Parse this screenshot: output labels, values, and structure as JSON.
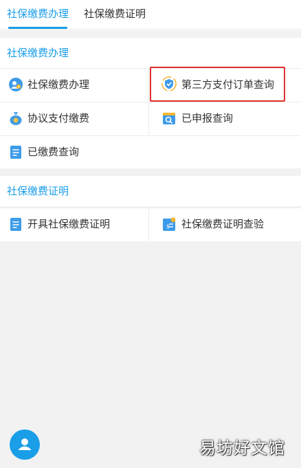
{
  "tabs": [
    {
      "label": "社保缴费办理",
      "active": true
    },
    {
      "label": "社保缴费证明",
      "active": false
    }
  ],
  "sections": [
    {
      "title": "社保缴费办理",
      "items": [
        {
          "label": "社保缴费办理",
          "icon": "social-security-icon"
        },
        {
          "label": "第三方支付订单查询",
          "icon": "shield-check-icon",
          "highlighted": true
        },
        {
          "label": "协议支付缴费",
          "icon": "money-bag-icon"
        },
        {
          "label": "已申报查询",
          "icon": "search-document-icon"
        },
        {
          "label": "已缴费查询",
          "icon": "document-list-icon"
        }
      ]
    },
    {
      "title": "社保缴费证明",
      "items": [
        {
          "label": "开具社保缴费证明",
          "icon": "document-list-icon"
        },
        {
          "label": "社保缴费证明查验",
          "icon": "certificate-verify-icon"
        }
      ]
    }
  ],
  "watermark": "易坊好文馆",
  "colors": {
    "accent": "#1a9ee8",
    "highlight_border": "#e0302e",
    "background": "#f2f2f2"
  }
}
